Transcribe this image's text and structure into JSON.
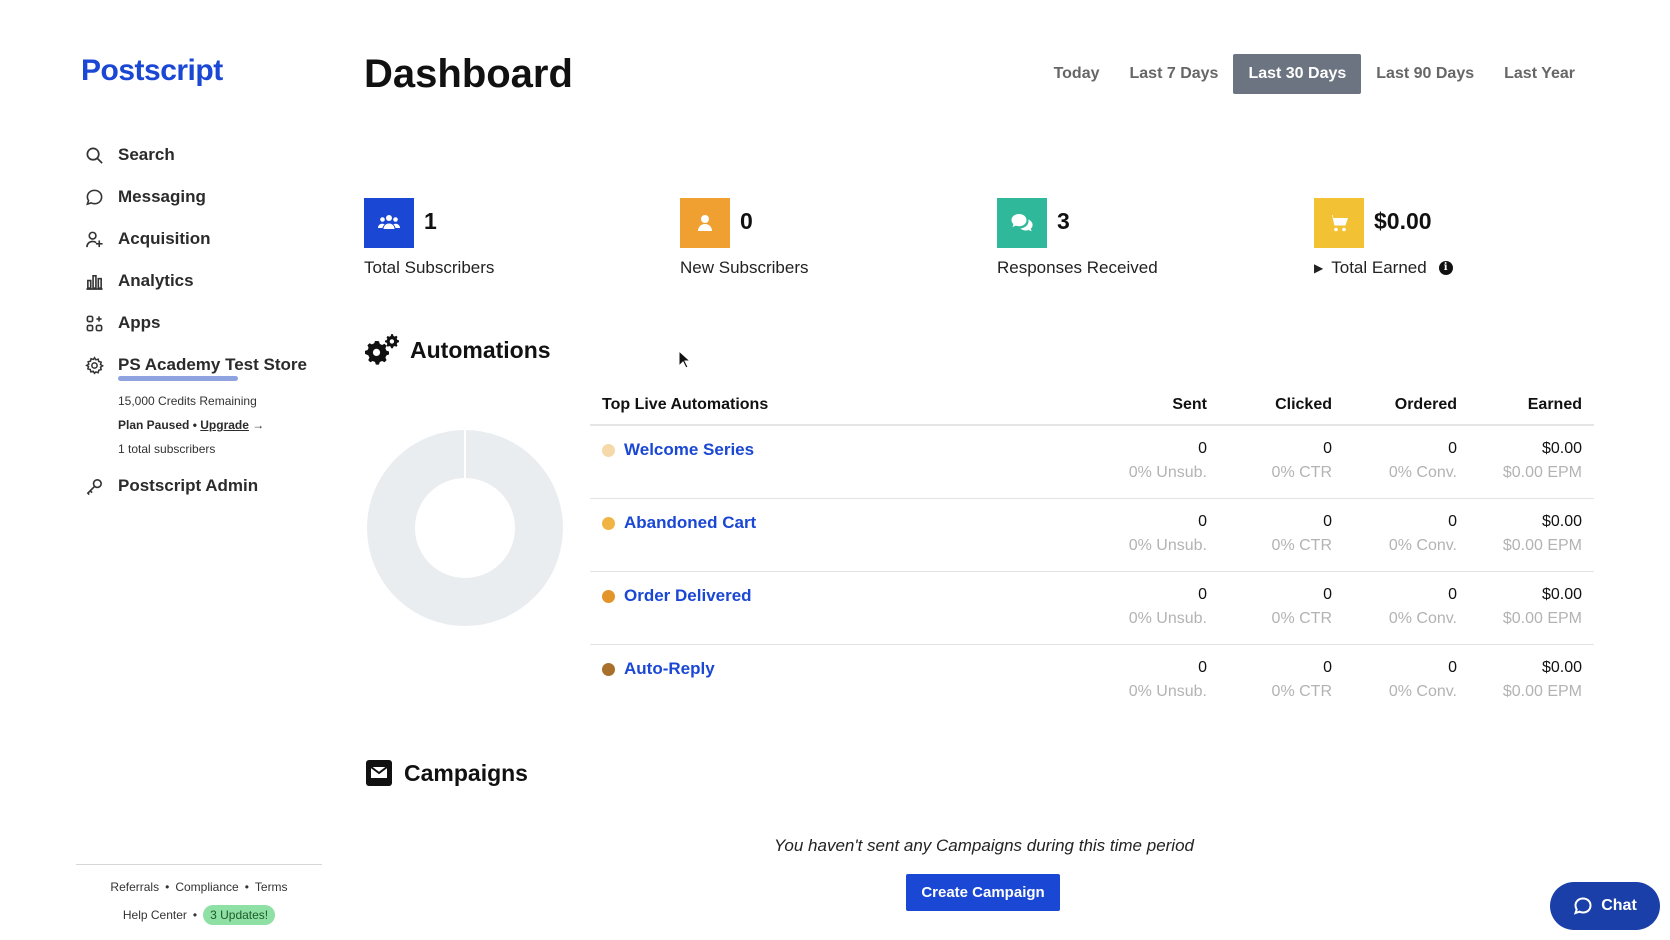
{
  "brand": {
    "logo_text": "Postscript",
    "primary_color": "#1a47d3"
  },
  "sidebar": {
    "items": [
      {
        "label": "Search",
        "icon": "search-icon"
      },
      {
        "label": "Messaging",
        "icon": "message-icon"
      },
      {
        "label": "Acquisition",
        "icon": "user-plus-icon"
      },
      {
        "label": "Analytics",
        "icon": "bar-chart-icon"
      },
      {
        "label": "Apps",
        "icon": "apps-icon"
      },
      {
        "label": "PS Academy Test Store",
        "icon": "gear-icon"
      }
    ],
    "store": {
      "credits": "15,000 Credits Remaining",
      "plan_status": "Plan Paused",
      "upgrade_label": "Upgrade",
      "subscribers": "1 total subscribers"
    },
    "admin": {
      "label": "Postscript Admin",
      "icon": "key-icon"
    },
    "footer": {
      "links": [
        "Referrals",
        "Compliance",
        "Terms"
      ],
      "help_center": "Help Center",
      "updates_badge": "3 Updates!"
    }
  },
  "header": {
    "title": "Dashboard",
    "date_ranges": [
      "Today",
      "Last 7 Days",
      "Last 30 Days",
      "Last 90 Days",
      "Last Year"
    ],
    "active_range": "Last 30 Days"
  },
  "stats": [
    {
      "value": "1",
      "label": "Total Subscribers",
      "color": "#1a47d3",
      "icon": "users-icon"
    },
    {
      "value": "0",
      "label": "New Subscribers",
      "color": "#f0a030",
      "icon": "user-icon"
    },
    {
      "value": "3",
      "label": "Responses Received",
      "color": "#2fb89a",
      "icon": "chat-bubbles-icon"
    },
    {
      "value": "$0.00",
      "label": "Total Earned",
      "color": "#f2c234",
      "icon": "cart-icon"
    }
  ],
  "automations": {
    "title": "Automations",
    "columns": [
      "Top Live Automations",
      "Sent",
      "Clicked",
      "Ordered",
      "Earned"
    ],
    "rows": [
      {
        "name": "Welcome Series",
        "dot_color": "#f6d9a8",
        "sent": "0",
        "unsub": "0% Unsub.",
        "clicked": "0",
        "ctr": "0% CTR",
        "ordered": "0",
        "conv": "0% Conv.",
        "earned": "$0.00",
        "epm": "$0.00 EPM"
      },
      {
        "name": "Abandoned Cart",
        "dot_color": "#f0b445",
        "sent": "0",
        "unsub": "0% Unsub.",
        "clicked": "0",
        "ctr": "0% CTR",
        "ordered": "0",
        "conv": "0% Conv.",
        "earned": "$0.00",
        "epm": "$0.00 EPM"
      },
      {
        "name": "Order Delivered",
        "dot_color": "#e3952a",
        "sent": "0",
        "unsub": "0% Unsub.",
        "clicked": "0",
        "ctr": "0% CTR",
        "ordered": "0",
        "conv": "0% Conv.",
        "earned": "$0.00",
        "epm": "$0.00 EPM"
      },
      {
        "name": "Auto-Reply",
        "dot_color": "#a8702a",
        "sent": "0",
        "unsub": "0% Unsub.",
        "clicked": "0",
        "ctr": "0% CTR",
        "ordered": "0",
        "conv": "0% Conv.",
        "earned": "$0.00",
        "epm": "$0.00 EPM"
      }
    ]
  },
  "campaigns": {
    "title": "Campaigns",
    "empty_message": "You haven't sent any Campaigns during this time period",
    "create_label": "Create Campaign"
  },
  "chat": {
    "label": "Chat"
  }
}
